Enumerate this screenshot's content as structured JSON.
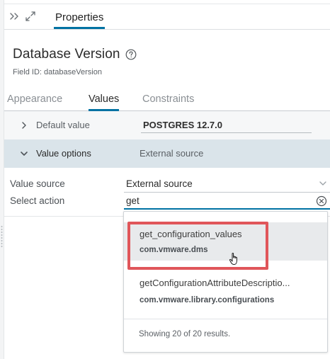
{
  "header": {
    "properties_tab": "Properties"
  },
  "field": {
    "title": "Database Version",
    "field_id": "Field ID: databaseVersion"
  },
  "tabs": [
    {
      "label": "Appearance",
      "active": false
    },
    {
      "label": "Values",
      "active": true
    },
    {
      "label": "Constraints",
      "active": false
    }
  ],
  "default_value": {
    "label": "Default value",
    "value": "POSTGRES 12.7.0"
  },
  "value_options": {
    "label": "Value options",
    "value": "External source"
  },
  "form": {
    "value_source_label": "Value source",
    "value_source_value": "External source",
    "select_action_label": "Select action",
    "select_action_value": "get"
  },
  "dropdown": {
    "items": [
      {
        "name": "get_configuration_values",
        "module": "com.vmware.dms"
      },
      {
        "name": "getConfigurationAttributeDescriptio...",
        "module": "com.vmware.library.configurations"
      }
    ],
    "results_text": "Showing 20 of 20 results."
  },
  "colors": {
    "accent": "#0072a3",
    "highlight": "#e0565a",
    "section_bg": "#dae4ea"
  },
  "icons": [
    "collapse-panel-icon",
    "expand-icon",
    "help-icon",
    "chevron-right-icon",
    "chevron-down-icon",
    "dropdown-caret-icon",
    "clear-icon",
    "hand-cursor-icon"
  ]
}
